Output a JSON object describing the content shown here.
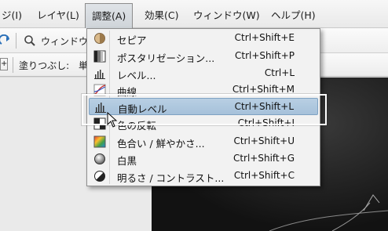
{
  "menubar": {
    "items": [
      {
        "label": "ジ(I)"
      },
      {
        "label": "レイヤ(L)"
      },
      {
        "label": "調整(A)"
      },
      {
        "label": "効果(C)"
      },
      {
        "label": "ウィンドウ(W)"
      },
      {
        "label": "ヘルプ(H)"
      }
    ]
  },
  "toolbar": {
    "window_label": "ウィンドウ",
    "fill_label": "塗りつぶし:",
    "fill_value": "単"
  },
  "adjust_menu": {
    "items": [
      {
        "label": "セピア",
        "shortcut": "Ctrl+Shift+E",
        "icon": "sepia-icon"
      },
      {
        "label": "ポスタリゼーション...",
        "shortcut": "Ctrl+Shift+P",
        "icon": "posterize-icon"
      },
      {
        "label": "レベル...",
        "shortcut": "Ctrl+L",
        "icon": "levels-icon"
      },
      {
        "label": "曲線",
        "shortcut": "Ctrl+Shift+M",
        "icon": "curves-icon"
      },
      {
        "label": "自動レベル",
        "shortcut": "Ctrl+Shift+L",
        "icon": "auto-level-icon"
      },
      {
        "label": "色の反転",
        "shortcut": "Ctrl+Shift+I",
        "icon": "invert-colors-icon"
      },
      {
        "label": "色合い / 鮮やかさ...",
        "shortcut": "Ctrl+Shift+U",
        "icon": "hue-saturation-icon"
      },
      {
        "label": "白黒",
        "shortcut": "Ctrl+Shift+G",
        "icon": "black-white-icon"
      },
      {
        "label": "明るさ / コントラスト...",
        "shortcut": "Ctrl+Shift+C",
        "icon": "brightness-contrast-icon"
      }
    ]
  },
  "colors": {
    "highlight": "#a6c1da",
    "menu_bg": "#f2f2f2"
  }
}
